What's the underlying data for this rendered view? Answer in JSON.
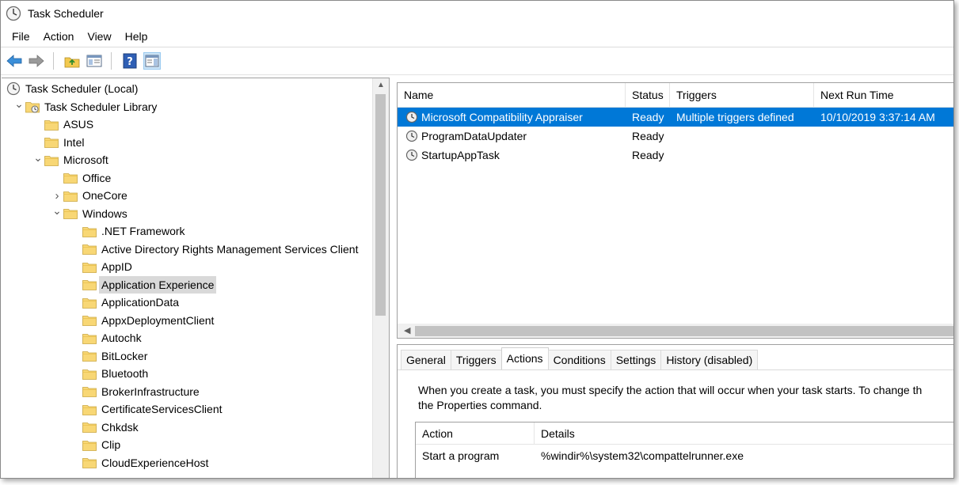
{
  "window": {
    "title": "Task Scheduler"
  },
  "menu": {
    "items": [
      "File",
      "Action",
      "View",
      "Help"
    ]
  },
  "toolbar": {
    "buttons": [
      "back-icon",
      "forward-icon",
      "up-folder-icon",
      "show-hide-console-tree-icon",
      "help-icon",
      "show-hide-action-pane-icon"
    ]
  },
  "tree": {
    "items": [
      {
        "label": "Task Scheduler (Local)",
        "icon": "clock-icon",
        "expander": ""
      },
      {
        "label": "Task Scheduler Library",
        "icon": "library-folder-icon",
        "expander": "expanded"
      },
      {
        "label": "ASUS",
        "icon": "folder-icon",
        "expander": ""
      },
      {
        "label": "Intel",
        "icon": "folder-icon",
        "expander": ""
      },
      {
        "label": "Microsoft",
        "icon": "folder-icon",
        "expander": "expanded"
      },
      {
        "label": "Office",
        "icon": "folder-icon",
        "expander": ""
      },
      {
        "label": "OneCore",
        "icon": "folder-icon",
        "expander": "collapsed"
      },
      {
        "label": "Windows",
        "icon": "folder-icon",
        "expander": "expanded"
      },
      {
        "label": ".NET Framework",
        "icon": "folder-icon",
        "expander": ""
      },
      {
        "label": "Active Directory Rights Management Services Client",
        "icon": "folder-icon",
        "expander": ""
      },
      {
        "label": "AppID",
        "icon": "folder-icon",
        "expander": ""
      },
      {
        "label": "Application Experience",
        "icon": "folder-icon",
        "expander": "",
        "selected": true
      },
      {
        "label": "ApplicationData",
        "icon": "folder-icon",
        "expander": ""
      },
      {
        "label": "AppxDeploymentClient",
        "icon": "folder-icon",
        "expander": ""
      },
      {
        "label": "Autochk",
        "icon": "folder-icon",
        "expander": ""
      },
      {
        "label": "BitLocker",
        "icon": "folder-icon",
        "expander": ""
      },
      {
        "label": "Bluetooth",
        "icon": "folder-icon",
        "expander": ""
      },
      {
        "label": "BrokerInfrastructure",
        "icon": "folder-icon",
        "expander": ""
      },
      {
        "label": "CertificateServicesClient",
        "icon": "folder-icon",
        "expander": ""
      },
      {
        "label": "Chkdsk",
        "icon": "folder-icon",
        "expander": ""
      },
      {
        "label": "Clip",
        "icon": "folder-icon",
        "expander": ""
      },
      {
        "label": "CloudExperienceHost",
        "icon": "folder-icon",
        "expander": ""
      }
    ]
  },
  "task_list": {
    "columns": [
      "Name",
      "Status",
      "Triggers",
      "Next Run Time"
    ],
    "rows": [
      {
        "name": "Microsoft Compatibility Appraiser",
        "status": "Ready",
        "triggers": "Multiple triggers defined",
        "next_run": "10/10/2019 3:37:14 AM",
        "selected": true
      },
      {
        "name": "ProgramDataUpdater",
        "status": "Ready",
        "triggers": "",
        "next_run": ""
      },
      {
        "name": "StartupAppTask",
        "status": "Ready",
        "triggers": "",
        "next_run": ""
      }
    ]
  },
  "detail": {
    "tabs": [
      "General",
      "Triggers",
      "Actions",
      "Conditions",
      "Settings",
      "History (disabled)"
    ],
    "active_tab": "Actions",
    "description_line1": "When you create a task, you must specify the action that will occur when your task starts.  To change th",
    "description_line2": "the Properties command.",
    "actions_table": {
      "columns": [
        "Action",
        "Details"
      ],
      "rows": [
        {
          "action": "Start a program",
          "details": "%windir%\\system32\\compattelrunner.exe"
        }
      ]
    }
  },
  "colors": {
    "selection": "#0078d7",
    "tree_selection": "#d9d9d9",
    "folder": "#f8d775"
  }
}
